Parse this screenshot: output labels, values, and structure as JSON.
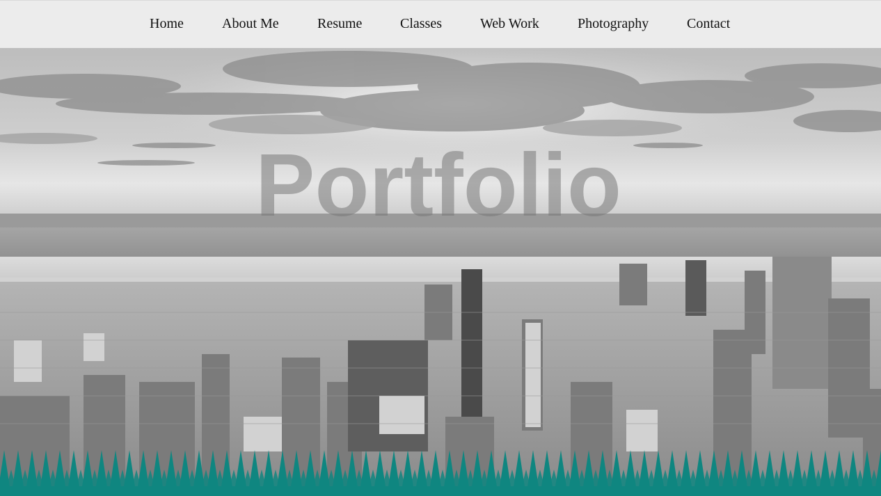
{
  "nav": {
    "items": [
      {
        "label": "Home"
      },
      {
        "label": "About Me"
      },
      {
        "label": "Resume"
      },
      {
        "label": "Classes"
      },
      {
        "label": "Web Work"
      },
      {
        "label": "Photography"
      },
      {
        "label": "Contact"
      }
    ]
  },
  "hero": {
    "title": "Portfolio"
  },
  "colors": {
    "nav_bg": "#ececec",
    "accent_teal": "#0f8680",
    "title_gray": "#787878"
  }
}
